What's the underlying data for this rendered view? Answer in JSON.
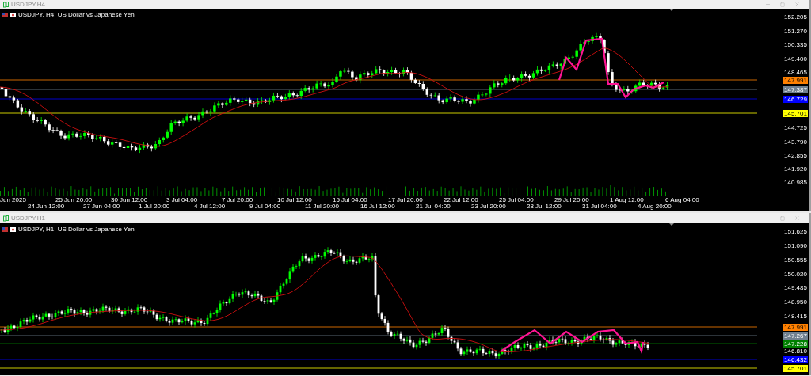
{
  "windows": [
    {
      "title": "USDJPY,H4",
      "header": "USDJPY, H4: US Dollar vs Japanese Yen",
      "price_ticks": [
        "152.205",
        "151.270",
        "150.335",
        "149.400",
        "148.465",
        "144.725",
        "143.790",
        "142.855",
        "141.920",
        "140.985"
      ],
      "price_tags": [
        {
          "text": "147.991",
          "color": "#ff8000"
        },
        {
          "text": "147.387",
          "color": "#708090"
        },
        {
          "text": "146.729",
          "color": "#0000ff"
        },
        {
          "text": "145.701",
          "color": "#ffff00"
        }
      ],
      "time_labels": [
        "Jun 2025",
        "24 Jun 12:00",
        "25 Jun 20:00",
        "27 Jun 04:00",
        "30 Jun 12:00",
        "1 Jul 20:00",
        "3 Jul 04:00",
        "4 Jul 12:00",
        "7 Jul 20:00",
        "9 Jul 04:00",
        "10 Jul 12:00",
        "11 Jul 20:00",
        "15 Jul 04:00",
        "16 Jul 12:00",
        "17 Jul 20:00",
        "21 Jul 04:00",
        "22 Jul 12:00",
        "23 Jul 20:00",
        "25 Jul 04:00",
        "28 Jul 12:00",
        "29 Jul 20:00",
        "31 Jul 04:00",
        "1 Aug 12:00",
        "4 Aug 20:00",
        "6 Aug 04:00"
      ]
    },
    {
      "title": "USDJPY,H1",
      "header": "USDJPY, H1: US Dollar vs Japanese Yen",
      "price_ticks": [
        "151.625",
        "151.090",
        "150.555",
        "150.020",
        "149.485",
        "148.950",
        "148.415",
        "146.810"
      ],
      "price_tags": [
        {
          "text": "147.991",
          "color": "#ff8000"
        },
        {
          "text": "147.267",
          "color": "#708090"
        },
        {
          "text": "147.228",
          "color": "#008000"
        },
        {
          "text": "146.432",
          "color": "#0000ff"
        },
        {
          "text": "145.701",
          "color": "#ffff00"
        }
      ]
    }
  ]
}
